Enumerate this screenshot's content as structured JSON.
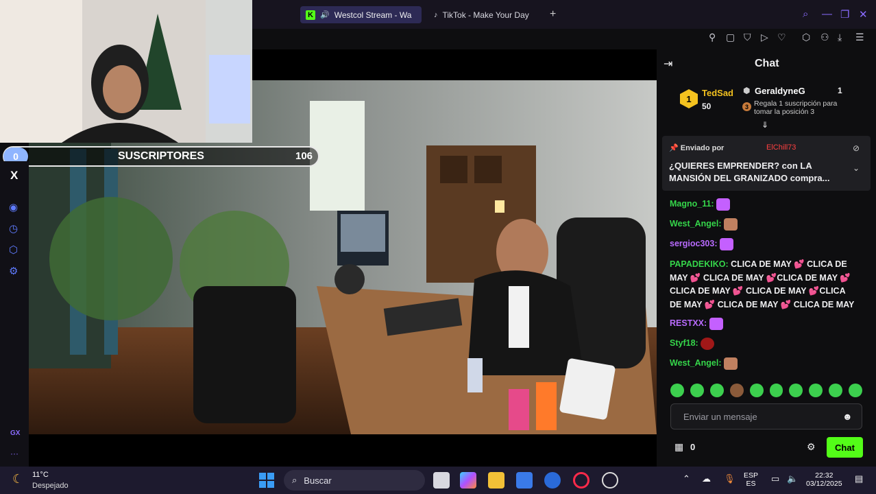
{
  "browser": {
    "tabs": [
      {
        "label": "Westcol Stream - Wa"
      },
      {
        "label": "TikTok - Make Your Day"
      }
    ],
    "new_tab": "+"
  },
  "overlay": {
    "sub_count": "0",
    "sub_label": "SUSCRIPTORES",
    "sub_goal": "106",
    "social": "X"
  },
  "chat": {
    "title": "Chat",
    "leaderboard": {
      "first": {
        "rank": "1",
        "name": "TedSad",
        "amount": "50"
      },
      "second": {
        "name": "GeraldyneG",
        "amount": "1",
        "gift_text": "Regala 1 suscripción para tomar la posición 3",
        "rank_next": "3"
      }
    },
    "pinned": {
      "by_label": "Enviado por",
      "user": "ElChill73",
      "text": "¿QUIERES EMPRENDER? con LA MANSIÓN DEL GRANIZADO compra..."
    },
    "messages": [
      {
        "user": "Magno_11:",
        "text": "",
        "color": "#35d64a"
      },
      {
        "user": "West_Angel:",
        "text": "",
        "color": "#35d64a"
      },
      {
        "user": "sergioc303:",
        "text": "",
        "color": "#b96bff"
      },
      {
        "user": "PAPADEKIKO:",
        "text": "CLICA DE MAY 💕 CLICA DE MAY 💕 CLICA DE MAY 💕CLICA DE MAY 💕 CLICA DE MAY 💕 CLICA DE MAY 💕CLICA DE MAY 💕 CLICA DE MAY 💕 CLICA DE MAY",
        "color": "#35d64a"
      },
      {
        "user": "RESTXX:",
        "text": "",
        "color": "#b96bff"
      },
      {
        "user": "Styf18:",
        "text": "",
        "color": "#35d64a"
      },
      {
        "user": "West_Angel:",
        "text": "",
        "color": "#35d64a"
      }
    ],
    "input_placeholder": "Enviar un mensaje",
    "points": "0",
    "send_label": "Chat"
  },
  "taskbar": {
    "weather_temp": "11°C",
    "weather_desc": "Despejado",
    "search_label": "Buscar",
    "lang_top": "ESP",
    "lang_bottom": "ES",
    "time": "22:32",
    "date": "03/12/2025"
  },
  "colors": {
    "accent": "#53fc18",
    "tab_active": "#2d2a55",
    "taskbar": "#1d1a2e"
  }
}
